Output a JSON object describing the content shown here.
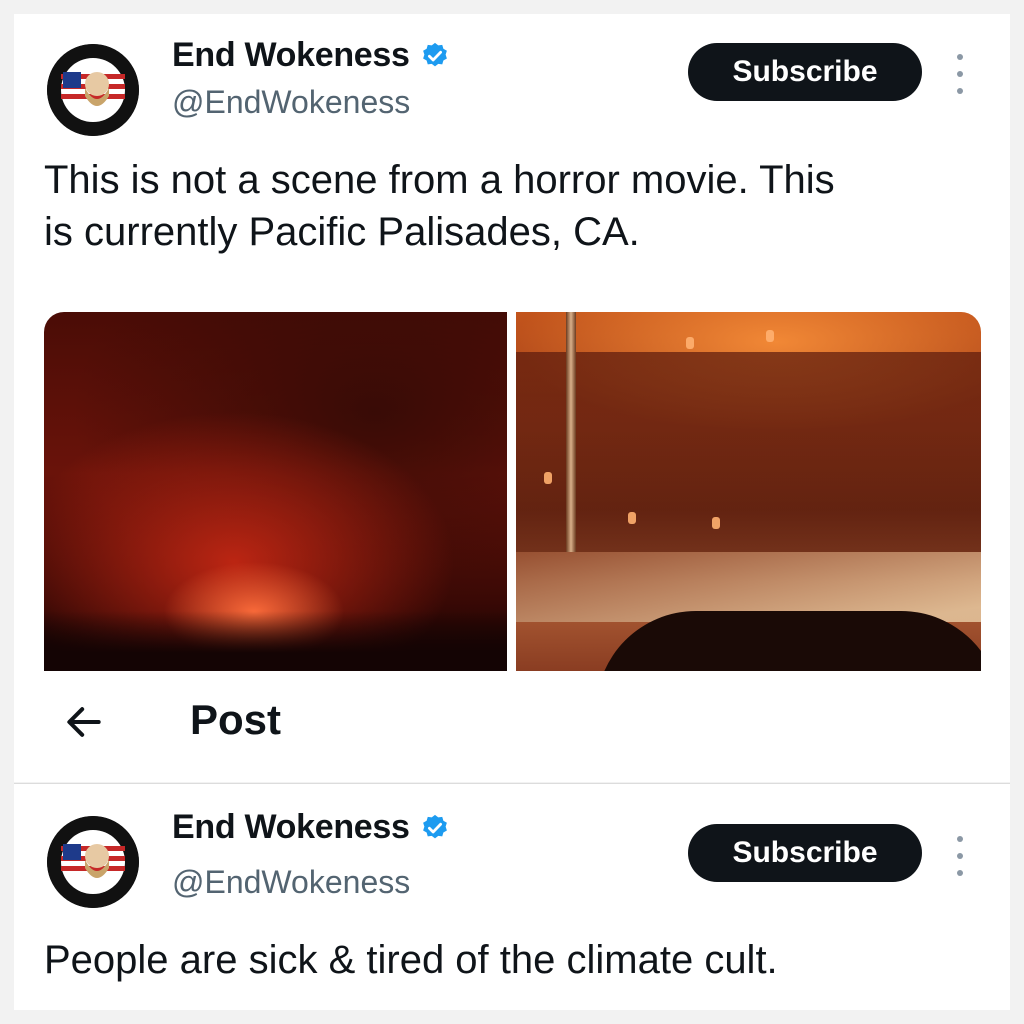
{
  "tweet1": {
    "author_name": "End Wokeness",
    "author_handle": "@EndWokeness",
    "subscribe_label": "Subscribe",
    "text_line1": "This is not a scene from a horror movie. This",
    "text_line2": "is currently Pacific Palisades, CA.",
    "media": [
      "video-still-fire-night",
      "video-still-smoky-street"
    ]
  },
  "postbar": {
    "title": "Post"
  },
  "tweet2": {
    "author_name": "End Wokeness",
    "author_handle": "@EndWokeness",
    "subscribe_label": "Subscribe",
    "text": "People are sick & tired of the climate cult."
  },
  "icons": {
    "verified": "verified-badge-icon",
    "more": "more-vertical-icon",
    "back": "arrow-left-icon"
  },
  "colors": {
    "verified": "#1d9bf0",
    "subscribe_bg": "#0f1419",
    "handle": "#536471"
  }
}
